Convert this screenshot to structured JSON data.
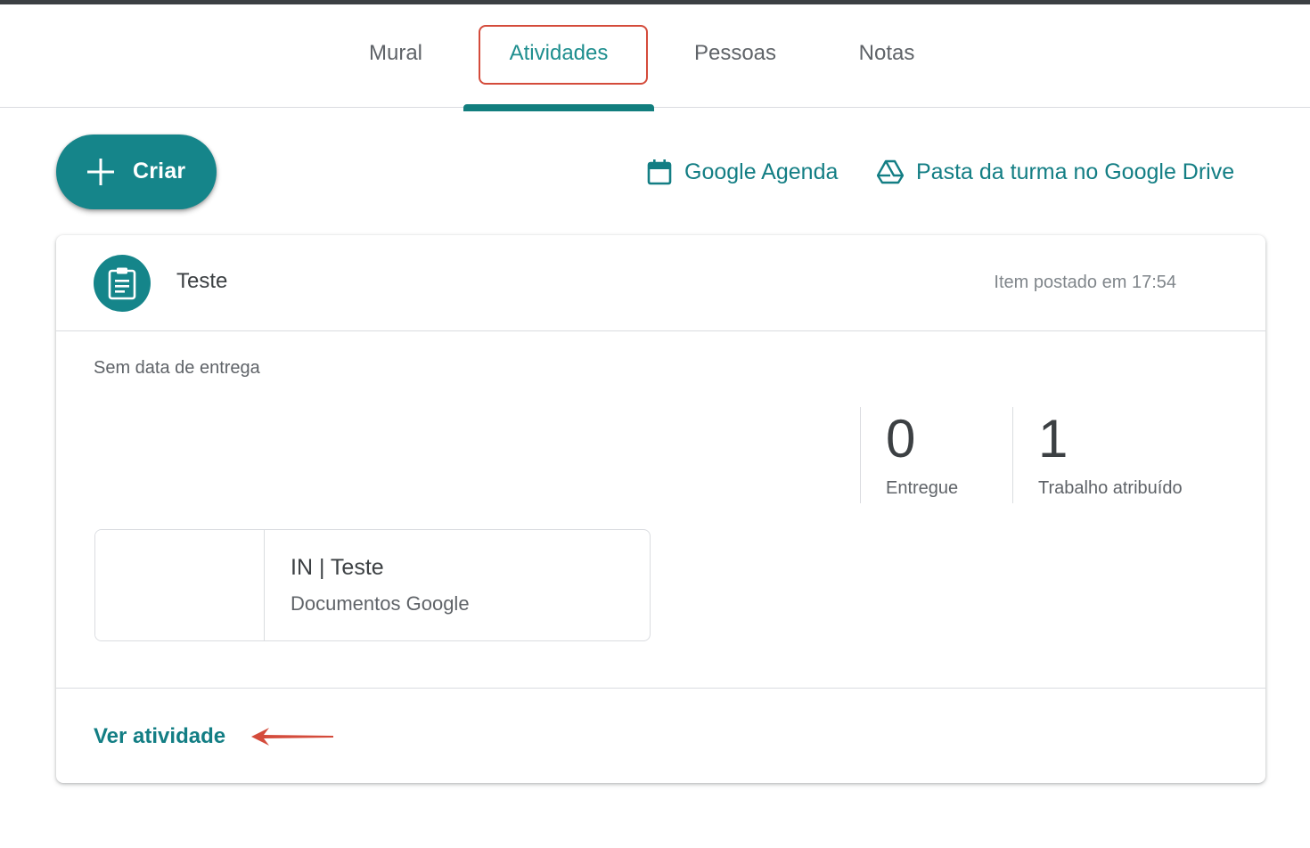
{
  "tabs": [
    {
      "label": "Mural",
      "active": false
    },
    {
      "label": "Atividades",
      "active": true
    },
    {
      "label": "Pessoas",
      "active": false
    },
    {
      "label": "Notas",
      "active": false
    }
  ],
  "toolbar": {
    "create_label": "Criar",
    "calendar_link": "Google Agenda",
    "drive_link": "Pasta da turma no Google Drive"
  },
  "assignment": {
    "title": "Teste",
    "posted": "Item postado em 17:54",
    "due": "Sem data de entrega",
    "stats": [
      {
        "value": "0",
        "label": "Entregue"
      },
      {
        "value": "1",
        "label": "Trabalho atribuído"
      }
    ],
    "attachment": {
      "title": "IN | Teste",
      "type": "Documentos Google"
    },
    "view_link": "Ver atividade"
  },
  "colors": {
    "accent": "#15858a",
    "link": "#137e84",
    "annotation": "#d44b3b"
  },
  "icons": {
    "create": "plus-icon",
    "calendar": "calendar-icon",
    "drive": "drive-icon",
    "assignment": "assignment-icon"
  }
}
